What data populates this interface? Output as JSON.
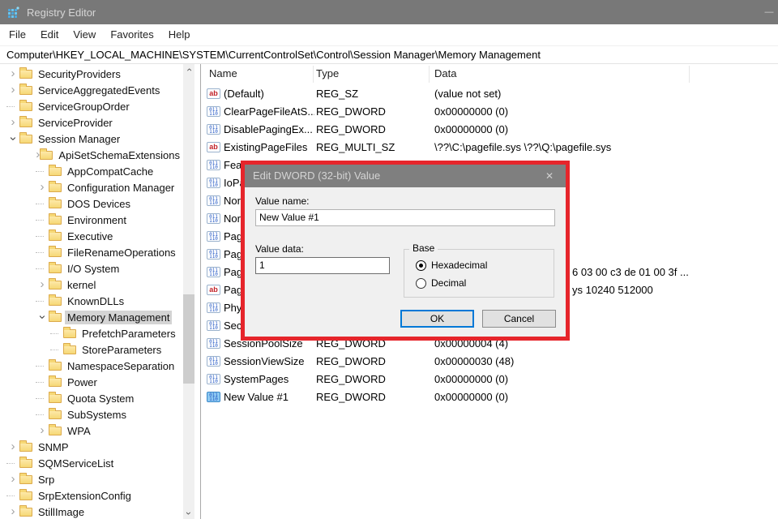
{
  "colors": {
    "titlebar_bg": "#787878",
    "dialog_title_bg": "#7f7f7f",
    "highlight_border_red": "#e6252b",
    "tree_selection_gray": "#d4d4d4",
    "ok_default_border_blue": "#0078d7",
    "folder_yellow": "#f6d876",
    "value_icon_blue": "#2257c4",
    "value_icon_red": "#c22128"
  },
  "icons": {
    "chevron": "›",
    "ab": "ab",
    "dword": "011\n110",
    "minimize": "—",
    "close": "✕"
  },
  "window": {
    "title": "Registry Editor"
  },
  "menu_bar": {
    "items": [
      "File",
      "Edit",
      "View",
      "Favorites",
      "Help"
    ]
  },
  "address_bar": {
    "path": "Computer\\HKEY_LOCAL_MACHINE\\SYSTEM\\CurrentControlSet\\Control\\Session Manager\\Memory Management"
  },
  "tree": {
    "items": [
      {
        "label": "SecurityProviders",
        "level": 1,
        "state": "collapsed",
        "selected": false
      },
      {
        "label": "ServiceAggregatedEvents",
        "level": 1,
        "state": "collapsed",
        "selected": false
      },
      {
        "label": "ServiceGroupOrder",
        "level": 1,
        "state": "leaf",
        "selected": false
      },
      {
        "label": "ServiceProvider",
        "level": 1,
        "state": "collapsed",
        "selected": false
      },
      {
        "label": "Session Manager",
        "level": 1,
        "state": "expanded",
        "selected": false
      },
      {
        "label": "ApiSetSchemaExtensions",
        "level": 2,
        "state": "collapsed",
        "selected": false
      },
      {
        "label": "AppCompatCache",
        "level": 2,
        "state": "leaf",
        "selected": false
      },
      {
        "label": "Configuration Manager",
        "level": 2,
        "state": "collapsed",
        "selected": false
      },
      {
        "label": "DOS Devices",
        "level": 2,
        "state": "leaf",
        "selected": false
      },
      {
        "label": "Environment",
        "level": 2,
        "state": "leaf",
        "selected": false
      },
      {
        "label": "Executive",
        "level": 2,
        "state": "leaf",
        "selected": false
      },
      {
        "label": "FileRenameOperations",
        "level": 2,
        "state": "leaf",
        "selected": false
      },
      {
        "label": "I/O System",
        "level": 2,
        "state": "leaf",
        "selected": false
      },
      {
        "label": "kernel",
        "level": 2,
        "state": "collapsed",
        "selected": false
      },
      {
        "label": "KnownDLLs",
        "level": 2,
        "state": "leaf",
        "selected": false
      },
      {
        "label": "Memory Management",
        "level": 2,
        "state": "expanded",
        "selected": true
      },
      {
        "label": "PrefetchParameters",
        "level": 3,
        "state": "leaf",
        "selected": false
      },
      {
        "label": "StoreParameters",
        "level": 3,
        "state": "leaf",
        "selected": false
      },
      {
        "label": "NamespaceSeparation",
        "level": 2,
        "state": "leaf",
        "selected": false
      },
      {
        "label": "Power",
        "level": 2,
        "state": "leaf",
        "selected": false
      },
      {
        "label": "Quota System",
        "level": 2,
        "state": "leaf",
        "selected": false
      },
      {
        "label": "SubSystems",
        "level": 2,
        "state": "leaf",
        "selected": false
      },
      {
        "label": "WPA",
        "level": 2,
        "state": "collapsed",
        "selected": false
      },
      {
        "label": "SNMP",
        "level": 1,
        "state": "collapsed",
        "selected": false
      },
      {
        "label": "SQMServiceList",
        "level": 1,
        "state": "leaf",
        "selected": false
      },
      {
        "label": "Srp",
        "level": 1,
        "state": "collapsed",
        "selected": false
      },
      {
        "label": "SrpExtensionConfig",
        "level": 1,
        "state": "leaf",
        "selected": false
      },
      {
        "label": "StillImage",
        "level": 1,
        "state": "collapsed",
        "selected": false
      }
    ]
  },
  "list": {
    "columns": [
      "Name",
      "Type",
      "Data"
    ],
    "rows": [
      {
        "icon": "ab",
        "name": "(Default)",
        "type": "REG_SZ",
        "data": "(value not set)",
        "selected": false
      },
      {
        "icon": "dword",
        "name": "ClearPageFileAtS...",
        "type": "REG_DWORD",
        "data": "0x00000000 (0)",
        "selected": false
      },
      {
        "icon": "dword",
        "name": "DisablePagingEx...",
        "type": "REG_DWORD",
        "data": "0x00000000 (0)",
        "selected": false
      },
      {
        "icon": "ab",
        "name": "ExistingPageFiles",
        "type": "REG_MULTI_SZ",
        "data": "\\??\\C:\\pagefile.sys \\??\\Q:\\pagefile.sys",
        "selected": false
      },
      {
        "icon": "dword",
        "name": "Fea",
        "type": "",
        "data": "",
        "selected": false
      },
      {
        "icon": "dword",
        "name": "IoPa",
        "type": "",
        "data": "",
        "selected": false
      },
      {
        "icon": "dword",
        "name": "Nor",
        "type": "",
        "data": "",
        "selected": false
      },
      {
        "icon": "dword",
        "name": "Nor",
        "type": "",
        "data": "",
        "selected": false
      },
      {
        "icon": "dword",
        "name": "Pag",
        "type": "",
        "data": "",
        "selected": false
      },
      {
        "icon": "dword",
        "name": "Pag",
        "type": "",
        "data": "",
        "selected": false
      },
      {
        "icon": "dword",
        "name": "Pag",
        "type": "",
        "data": "",
        "data_fragment": "6 03 00 c3 de 01 00 3f ...",
        "selected": false
      },
      {
        "icon": "ab",
        "name": "Pag",
        "type": "",
        "data": "",
        "data_fragment": "ys 10240 512000",
        "selected": false
      },
      {
        "icon": "dword",
        "name": "Phy",
        "type": "",
        "data": "",
        "selected": false
      },
      {
        "icon": "dword",
        "name": "Sec",
        "type": "",
        "data": "",
        "selected": false
      },
      {
        "icon": "dword",
        "name": "SessionPoolSize",
        "type": "REG_DWORD",
        "data": "0x00000004 (4)",
        "selected": false
      },
      {
        "icon": "dword",
        "name": "SessionViewSize",
        "type": "REG_DWORD",
        "data": "0x00000030 (48)",
        "selected": false
      },
      {
        "icon": "dword",
        "name": "SystemPages",
        "type": "REG_DWORD",
        "data": "0x00000000 (0)",
        "selected": false
      },
      {
        "icon": "dword",
        "name": "New Value #1",
        "type": "REG_DWORD",
        "data": "0x00000000 (0)",
        "selected": true
      }
    ]
  },
  "dialog": {
    "title": "Edit DWORD (32-bit) Value",
    "value_name_label": "Value name:",
    "value_name": "New Value #1",
    "value_data_label": "Value data:",
    "value_data": "1",
    "base_group_label": "Base",
    "base_options": [
      {
        "label": "Hexadecimal",
        "selected": true
      },
      {
        "label": "Decimal",
        "selected": false
      }
    ],
    "ok_label": "OK",
    "cancel_label": "Cancel"
  }
}
